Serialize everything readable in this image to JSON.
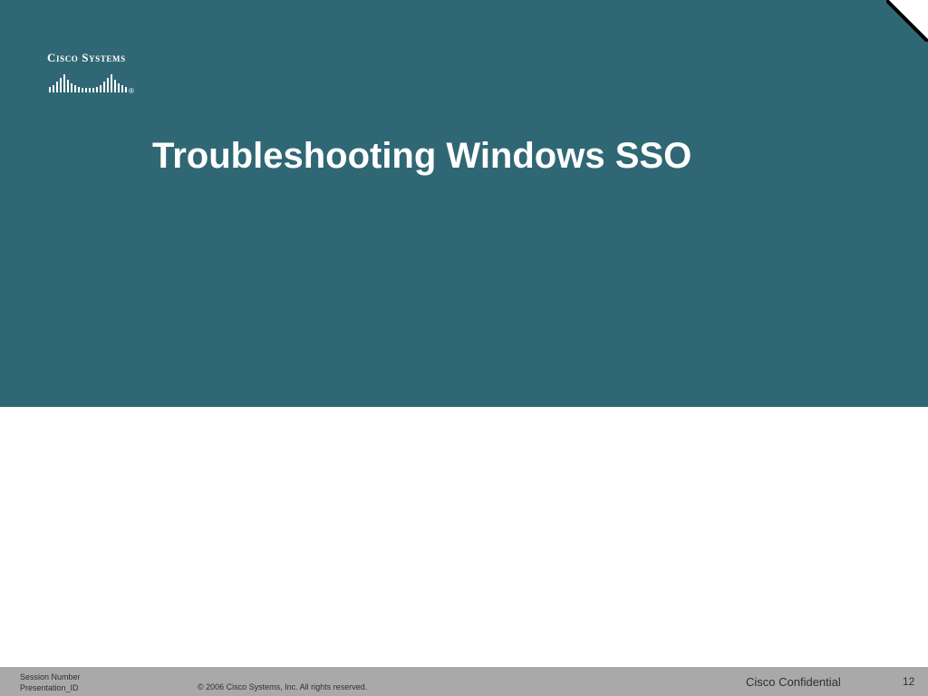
{
  "slide": {
    "title": "Troubleshooting Windows SSO",
    "banner_color": "#306774"
  },
  "logo": {
    "brand_text": "Cisco Systems",
    "registered_mark": "®",
    "icon": "cisco-bridge-logo-icon"
  },
  "footer": {
    "session_number": "Session Number",
    "presentation_id": "Presentation_ID",
    "copyright": "© 2006 Cisco Systems, Inc. All rights reserved.",
    "confidential": "Cisco Confidential",
    "page_number": "12"
  }
}
